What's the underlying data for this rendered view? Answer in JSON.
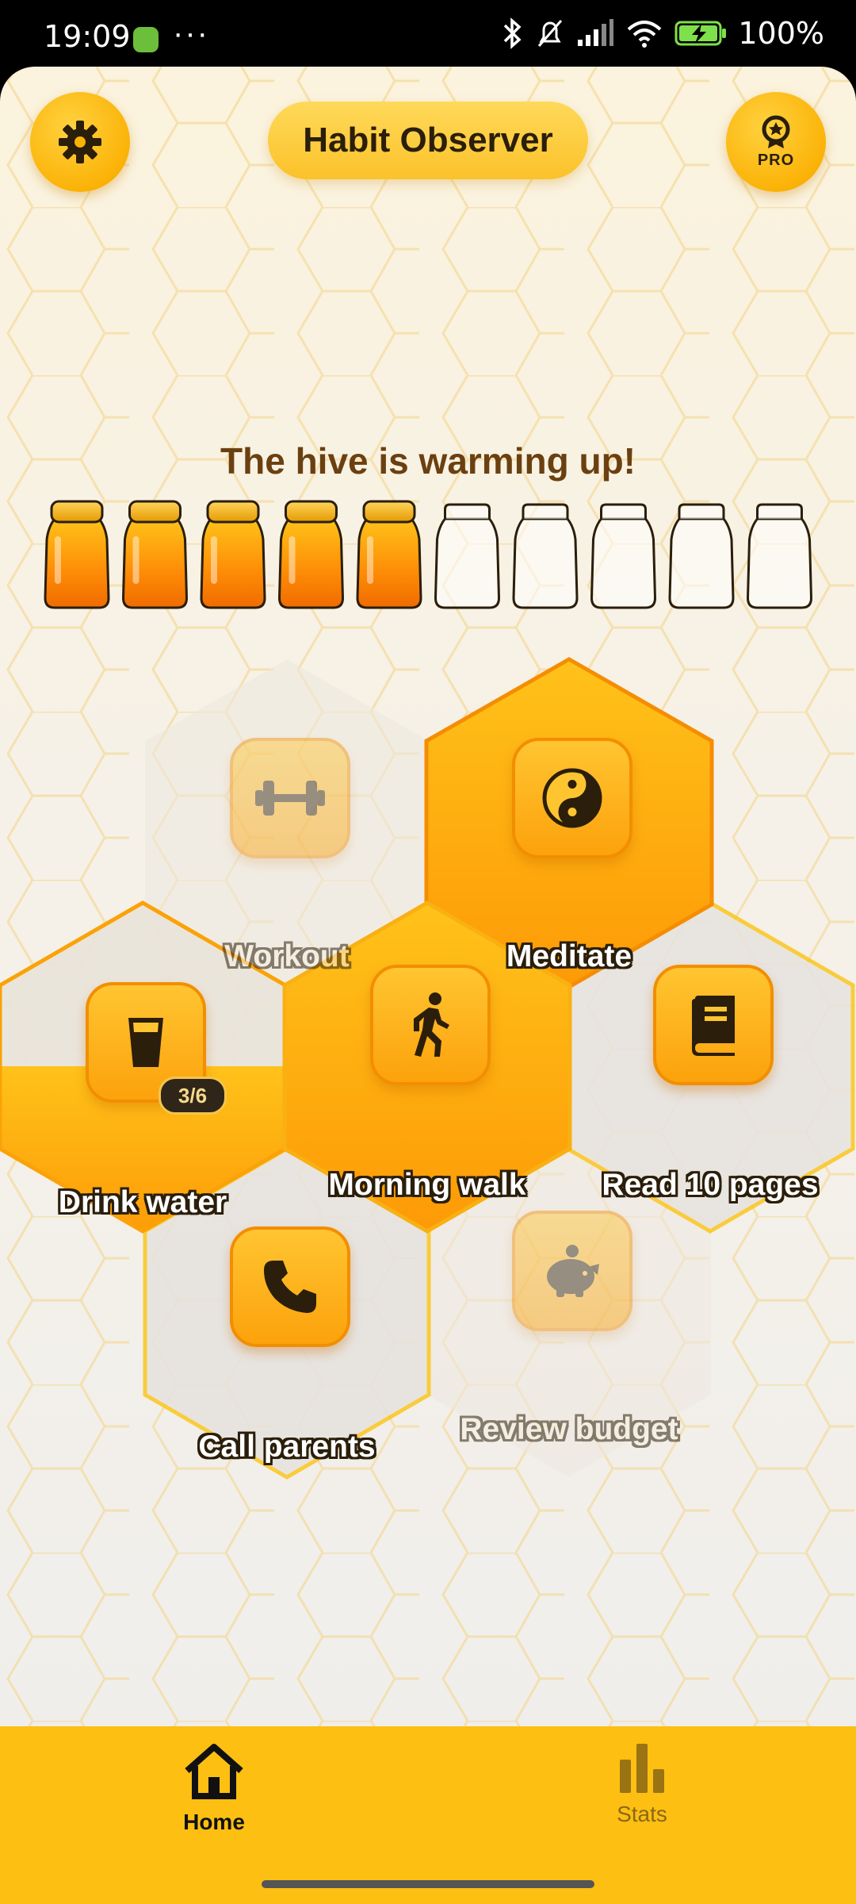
{
  "status_bar": {
    "time": "19:09",
    "dots": "···",
    "battery_percent": "100%"
  },
  "header": {
    "title": "Habit Observer",
    "settings_icon": "gear-icon",
    "pro_icon": "award-badge-icon",
    "pro_label": "PRO"
  },
  "hive": {
    "message": "The hive is warming up!",
    "jars_filled": 5,
    "jars_total": 10
  },
  "habits": [
    {
      "id": "workout",
      "label": "Workout",
      "icon": "dumbbell-icon",
      "state": "inactive"
    },
    {
      "id": "meditate",
      "label": "Meditate",
      "icon": "yin-yang-icon",
      "state": "completed"
    },
    {
      "id": "drink-water",
      "label": "Drink water",
      "icon": "glass-icon",
      "state": "partial",
      "progress": "3/6",
      "fill_fraction": 0.5
    },
    {
      "id": "morning-walk",
      "label": "Morning walk",
      "icon": "walking-icon",
      "state": "completed"
    },
    {
      "id": "read",
      "label": "Read 10 pages",
      "icon": "book-icon",
      "state": "pending"
    },
    {
      "id": "call-parents",
      "label": "Call parents",
      "icon": "phone-icon",
      "state": "pending"
    },
    {
      "id": "review-budget",
      "label": "Review budget",
      "icon": "piggy-bank-icon",
      "state": "inactive"
    }
  ],
  "nav": {
    "home": {
      "label": "Home",
      "icon": "home-icon",
      "active": true
    },
    "stats": {
      "label": "Stats",
      "icon": "bar-chart-icon",
      "active": false
    }
  },
  "colors": {
    "accent": "#FCBF12",
    "honey": "#FCA20C",
    "text_dark": "#2B1E0A",
    "hive_message": "#6B4010"
  }
}
